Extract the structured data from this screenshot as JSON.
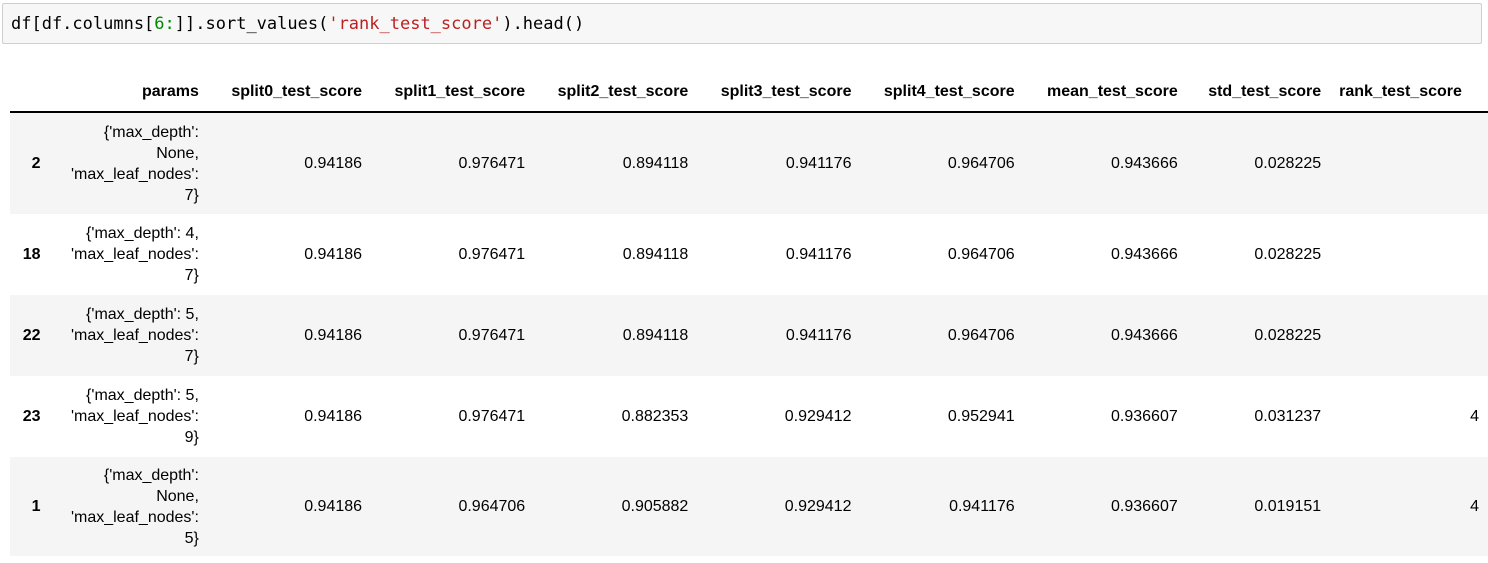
{
  "code_cell": {
    "prefix": "df[df.columns[",
    "number": "6",
    "colon": ":",
    "middle": "]].sort_values(",
    "string": "'rank_test_score'",
    "suffix": ").head()"
  },
  "table": {
    "columns": [
      "params",
      "split0_test_score",
      "split1_test_score",
      "split2_test_score",
      "split3_test_score",
      "split4_test_score",
      "mean_test_score",
      "std_test_score",
      "rank_test_score"
    ],
    "rows": [
      {
        "index": "2",
        "params_lines": [
          "{'max_depth':",
          "None,",
          "'max_leaf_nodes':",
          "7}"
        ],
        "values": [
          "0.94186",
          "0.976471",
          "0.894118",
          "0.941176",
          "0.964706",
          "0.943666",
          "0.028225",
          ""
        ]
      },
      {
        "index": "18",
        "params_lines": [
          "{'max_depth': 4,",
          "'max_leaf_nodes':",
          "7}"
        ],
        "values": [
          "0.94186",
          "0.976471",
          "0.894118",
          "0.941176",
          "0.964706",
          "0.943666",
          "0.028225",
          ""
        ]
      },
      {
        "index": "22",
        "params_lines": [
          "{'max_depth': 5,",
          "'max_leaf_nodes':",
          "7}"
        ],
        "values": [
          "0.94186",
          "0.976471",
          "0.894118",
          "0.941176",
          "0.964706",
          "0.943666",
          "0.028225",
          ""
        ]
      },
      {
        "index": "23",
        "params_lines": [
          "{'max_depth': 5,",
          "'max_leaf_nodes':",
          "9}"
        ],
        "values": [
          "0.94186",
          "0.976471",
          "0.882353",
          "0.929412",
          "0.952941",
          "0.936607",
          "0.031237",
          "4"
        ]
      },
      {
        "index": "1",
        "params_lines": [
          "{'max_depth':",
          "None,",
          "'max_leaf_nodes':",
          "5}"
        ],
        "values": [
          "0.94186",
          "0.964706",
          "0.905882",
          "0.929412",
          "0.941176",
          "0.936607",
          "0.019151",
          "4"
        ]
      }
    ]
  }
}
